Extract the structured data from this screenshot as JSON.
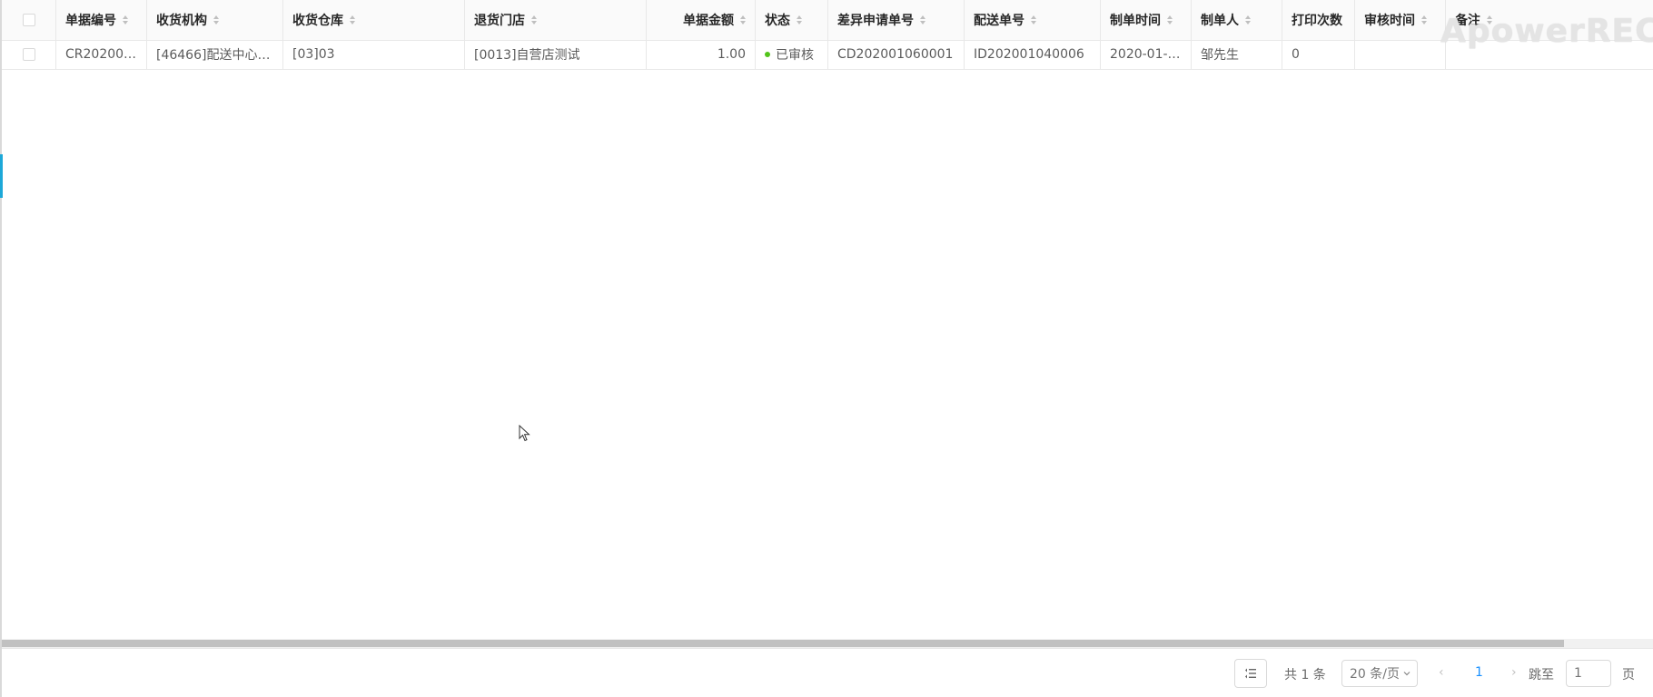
{
  "table": {
    "columns": [
      {
        "label": "单据编号",
        "sortable": true
      },
      {
        "label": "收货机构",
        "sortable": true
      },
      {
        "label": "收货仓库",
        "sortable": true
      },
      {
        "label": "退货门店",
        "sortable": true
      },
      {
        "label": "单据金额",
        "sortable": true
      },
      {
        "label": "状态",
        "sortable": true
      },
      {
        "label": "差异申请单号",
        "sortable": true
      },
      {
        "label": "配送单号",
        "sortable": true
      },
      {
        "label": "制单时间",
        "sortable": true
      },
      {
        "label": "制单人",
        "sortable": true
      },
      {
        "label": "打印次数",
        "sortable": false
      },
      {
        "label": "审核时间",
        "sortable": true
      },
      {
        "label": "备注",
        "sortable": true
      }
    ],
    "rows": [
      {
        "doc_no": "CR20200…",
        "receiving_org": "[46466]配送中心…",
        "receiving_warehouse": "[03]03",
        "return_store": "[0013]自营店测试",
        "amount": "1.00",
        "status": "已审核",
        "diff_request_no": "CD202001060001",
        "delivery_no": "ID202001040006",
        "created_time": "2020-01-0…",
        "creator": "邹先生",
        "print_count": "0",
        "audit_time": "",
        "remark": ""
      }
    ]
  },
  "watermark": "ApowerREC",
  "pagination": {
    "total": "共 1 条",
    "page_size": "20 条/页",
    "current_page": "1",
    "jump_label": "跳至",
    "jump_value": "1",
    "page_suffix": "页",
    "settings_icon": "column-settings-icon"
  },
  "colors": {
    "header_bg": "#fafafa",
    "border": "#e8e8e8",
    "status_success": "#52c41a",
    "accent": "#1890ff"
  }
}
